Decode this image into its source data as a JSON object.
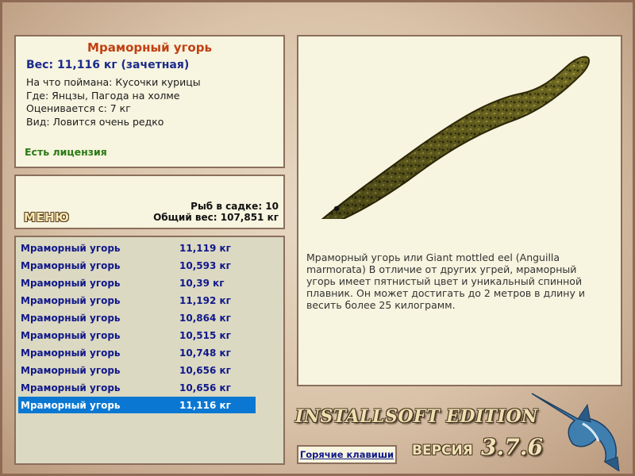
{
  "fish": {
    "title": "Мраморный угорь",
    "weight_line": "Вес: 11,116 кг (зачетная)",
    "bait_line": "На что поймана: Кусочки курицы",
    "where_line": "Где: Янцзы, Пагода на холме",
    "value_line": "Оценивается с: 7 кг",
    "species_line": "Вид: Ловится очень редко",
    "license": "Есть лицензия"
  },
  "summary": {
    "menu_label": "МЕНЮ",
    "fish_in_tank": "Рыб в садке: 10",
    "total_weight": "Общий вес: 107,851 кг"
  },
  "catch_list": [
    {
      "name": "Мраморный угорь",
      "weight": "11,119 кг"
    },
    {
      "name": "Мраморный угорь",
      "weight": "10,593 кг"
    },
    {
      "name": "Мраморный угорь",
      "weight": "10,39 кг"
    },
    {
      "name": "Мраморный угорь",
      "weight": "11,192 кг"
    },
    {
      "name": "Мраморный угорь",
      "weight": "10,864 кг"
    },
    {
      "name": "Мраморный угорь",
      "weight": "10,515 кг"
    },
    {
      "name": "Мраморный угорь",
      "weight": "10,748 кг"
    },
    {
      "name": "Мраморный угорь",
      "weight": "10,656 кг"
    },
    {
      "name": "Мраморный угорь",
      "weight": "10,656 кг"
    },
    {
      "name": "Мраморный угорь",
      "weight": "11,116 кг",
      "selected": true
    }
  ],
  "description": "Мраморный угорь или Giant mottled eel (Anguilla marmorata) В отличие от других угрей, мраморный угорь имеет пятнистый цвет и уникальный спинной плавник. Он может достигать до 2 метров в длину и весить более 25 килограмм.",
  "branding": {
    "edition": "INSTALLSOFT EDITION",
    "version_label": "ВЕРСИЯ",
    "version_number": "3.7.6"
  },
  "hotkeys_label": "Горячие клавиши",
  "colors": {
    "title_red": "#c04012",
    "list_blue": "#10188a",
    "selected_row": "#0a78d2",
    "license_green": "#2a7a16",
    "panel_bg": "#f7f4df"
  }
}
